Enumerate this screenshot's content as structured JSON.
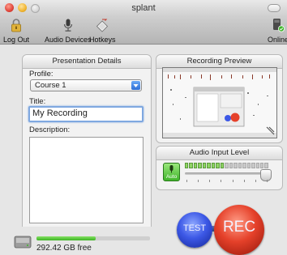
{
  "window": {
    "title": "splant"
  },
  "toolbar": {
    "items": [
      {
        "label": "Log Out",
        "icon": "lock-icon"
      },
      {
        "label": "Audio Devices",
        "icon": "microphone-icon"
      },
      {
        "label": "Hotkeys",
        "icon": "hotkey-icon"
      }
    ],
    "status_label": "Online",
    "status_icon": "online-status-icon"
  },
  "presentation": {
    "header": "Presentation Details",
    "profile_label": "Profile:",
    "profile_value": "Course 1",
    "title_label": "Title:",
    "title_value": "My Recording",
    "description_label": "Description:",
    "description_value": ""
  },
  "preview": {
    "header": "Recording Preview"
  },
  "audio": {
    "header": "Audio Input Level",
    "auto_label": "Auto",
    "meter_total_segments": 19,
    "meter_active_segments": 9,
    "input_level_fraction": 0.96,
    "colors": {
      "active": "#8fd464",
      "inactive": "#c9c9c9"
    }
  },
  "disk": {
    "free_text": "292.42 GB free",
    "used_fraction": 0.52
  },
  "controls": {
    "test_label": "TEST",
    "rec_label": "REC"
  }
}
